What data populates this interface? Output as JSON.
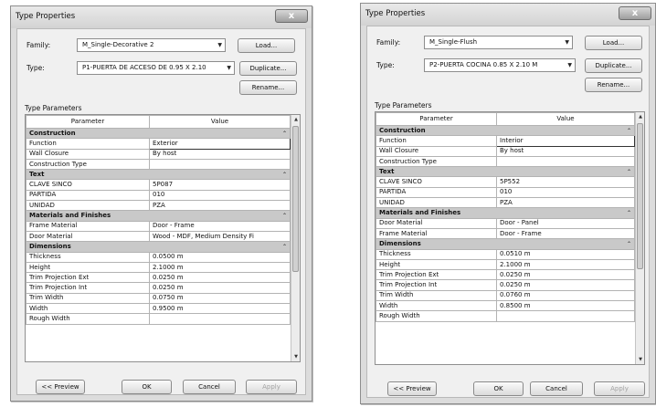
{
  "dialogs": [
    {
      "title": "Type Properties",
      "close_glyph": "x",
      "family_label": "Family:",
      "family_value": "M_Single-Decorative 2",
      "type_label": "Type:",
      "type_value": "P1-PUERTA DE ACCESO DE 0.95 X 2.10",
      "load_button": "Load...",
      "duplicate_button": "Duplicate...",
      "rename_button": "Rename...",
      "type_parameters_label": "Type Parameters",
      "col_parameter": "Parameter",
      "col_value": "Value",
      "groups": [
        {
          "name": "Construction",
          "rows": [
            {
              "param": "Function",
              "value": "Exterior"
            },
            {
              "param": "Wall Closure",
              "value": "By host"
            },
            {
              "param": "Construction Type",
              "value": ""
            }
          ]
        },
        {
          "name": "Text",
          "rows": [
            {
              "param": "CLAVE SINCO",
              "value": "5P087"
            },
            {
              "param": "PARTIDA",
              "value": "010"
            },
            {
              "param": "UNIDAD",
              "value": "PZA"
            }
          ]
        },
        {
          "name": "Materials and Finishes",
          "rows": [
            {
              "param": "Frame Material",
              "value": "Door - Frame"
            },
            {
              "param": "Door Material",
              "value": "Wood - MDF, Medium Density Fi"
            }
          ]
        },
        {
          "name": "Dimensions",
          "rows": [
            {
              "param": "Thickness",
              "value": "0.0500 m"
            },
            {
              "param": "Height",
              "value": "2.1000 m"
            },
            {
              "param": "Trim Projection Ext",
              "value": "0.0250 m"
            },
            {
              "param": "Trim Projection Int",
              "value": "0.0250 m"
            },
            {
              "param": "Trim Width",
              "value": "0.0750 m"
            },
            {
              "param": "Width",
              "value": "0.9500 m"
            },
            {
              "param": "Rough Width",
              "value": ""
            }
          ]
        }
      ],
      "preview_button": "<< Preview",
      "ok_button": "OK",
      "cancel_button": "Cancel",
      "apply_button": "Apply"
    },
    {
      "title": "Type Properties",
      "close_glyph": "x",
      "family_label": "Family:",
      "family_value": "M_Single-Flush",
      "type_label": "Type:",
      "type_value": "P2-PUERTA COCINA 0.85 X 2.10 M",
      "load_button": "Load...",
      "duplicate_button": "Duplicate...",
      "rename_button": "Rename...",
      "type_parameters_label": "Type Parameters",
      "col_parameter": "Parameter",
      "col_value": "Value",
      "groups": [
        {
          "name": "Construction",
          "rows": [
            {
              "param": "Function",
              "value": "Interior"
            },
            {
              "param": "Wall Closure",
              "value": "By host"
            },
            {
              "param": "Construction Type",
              "value": ""
            }
          ]
        },
        {
          "name": "Text",
          "rows": [
            {
              "param": "CLAVE SINCO",
              "value": "5P552"
            },
            {
              "param": "PARTIDA",
              "value": "010"
            },
            {
              "param": "UNIDAD",
              "value": "PZA"
            }
          ]
        },
        {
          "name": "Materials and Finishes",
          "rows": [
            {
              "param": "Door Material",
              "value": "Door - Panel"
            },
            {
              "param": "Frame Material",
              "value": "Door - Frame"
            }
          ]
        },
        {
          "name": "Dimensions",
          "rows": [
            {
              "param": "Thickness",
              "value": "0.0510 m"
            },
            {
              "param": "Height",
              "value": "2.1000 m"
            },
            {
              "param": "Trim Projection Ext",
              "value": "0.0250 m"
            },
            {
              "param": "Trim Projection Int",
              "value": "0.0250 m"
            },
            {
              "param": "Trim Width",
              "value": "0.0760 m"
            },
            {
              "param": "Width",
              "value": "0.8500 m"
            },
            {
              "param": "Rough Width",
              "value": ""
            }
          ]
        }
      ],
      "preview_button": "<< Preview",
      "ok_button": "OK",
      "cancel_button": "Cancel",
      "apply_button": "Apply"
    }
  ]
}
